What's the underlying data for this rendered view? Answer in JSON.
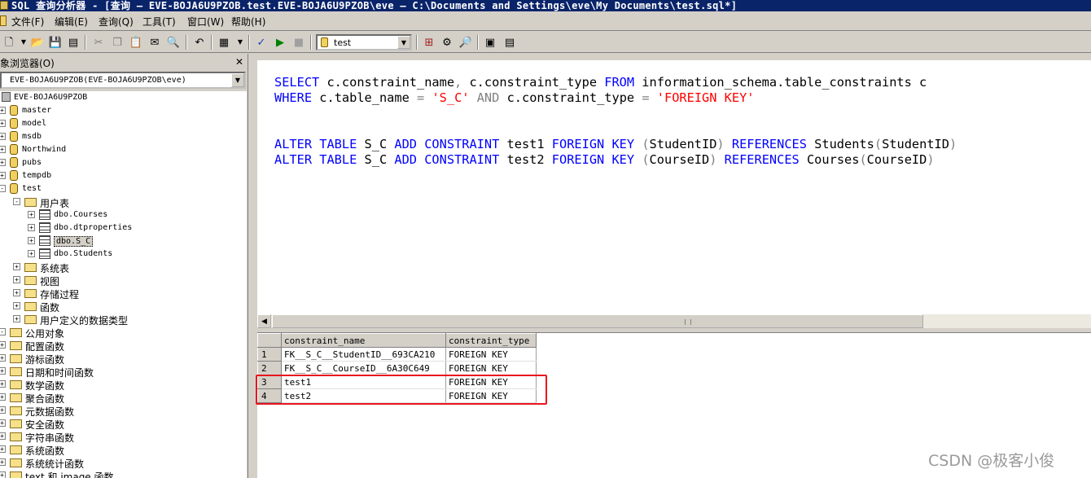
{
  "window": {
    "title": "SQL 查询分析器 - [查询 — EVE-BOJA6U9PZOB.test.EVE-BOJA6U9PZOB\\eve — C:\\Documents and Settings\\eve\\My Documents\\test.sql*]"
  },
  "menu": {
    "items": [
      "文件(F)",
      "编辑(E)",
      "查询(Q)",
      "工具(T)",
      "窗口(W)",
      "帮助(H)"
    ]
  },
  "toolbar": {
    "database": "test",
    "icons": [
      "new-query-icon",
      "open-icon",
      "save-icon",
      "load-script-icon",
      "cut-icon",
      "copy-icon",
      "paste-icon",
      "clear-icon",
      "find-icon",
      "undo-icon",
      "results-mode-icon",
      "parse-icon",
      "execute-icon",
      "stop-icon",
      "show-plan-icon",
      "object-browser-icon",
      "object-search-icon",
      "properties-icon",
      "show-results-icon"
    ]
  },
  "object_browser": {
    "title": "象浏览器(O)",
    "server_select": "EVE-BOJA6U9PZOB(EVE-BOJA6U9PZOB\\eve)",
    "tree": [
      {
        "label": "EVE-BOJA6U9PZOB",
        "type": "server",
        "level": 0
      },
      {
        "label": "master",
        "type": "db",
        "level": 1,
        "toggle": "+"
      },
      {
        "label": "model",
        "type": "db",
        "level": 1,
        "toggle": "+"
      },
      {
        "label": "msdb",
        "type": "db",
        "level": 1,
        "toggle": "+"
      },
      {
        "label": "Northwind",
        "type": "db",
        "level": 1,
        "toggle": "+"
      },
      {
        "label": "pubs",
        "type": "db",
        "level": 1,
        "toggle": "+"
      },
      {
        "label": "tempdb",
        "type": "db",
        "level": 1,
        "toggle": "+"
      },
      {
        "label": "test",
        "type": "db",
        "level": 1,
        "toggle": "-"
      },
      {
        "label": "用户表",
        "type": "folder",
        "level": 2,
        "toggle": "-"
      },
      {
        "label": "dbo.Courses",
        "type": "table",
        "level": 3,
        "toggle": "+"
      },
      {
        "label": "dbo.dtproperties",
        "type": "table",
        "level": 3,
        "toggle": "+"
      },
      {
        "label": "dbo.S_C",
        "type": "table",
        "level": 3,
        "toggle": "+",
        "selected": true
      },
      {
        "label": "dbo.Students",
        "type": "table",
        "level": 3,
        "toggle": "+"
      },
      {
        "label": "系统表",
        "type": "folder",
        "level": 2,
        "toggle": "+"
      },
      {
        "label": "视图",
        "type": "folder",
        "level": 2,
        "toggle": "+"
      },
      {
        "label": "存储过程",
        "type": "folder",
        "level": 2,
        "toggle": "+"
      },
      {
        "label": "函数",
        "type": "folder",
        "level": 2,
        "toggle": "+"
      },
      {
        "label": "用户定义的数据类型",
        "type": "folder",
        "level": 2,
        "toggle": "+"
      },
      {
        "label": "公用对象",
        "type": "folder",
        "level": 0,
        "toggle": "-"
      },
      {
        "label": "配置函数",
        "type": "folder",
        "level": 1,
        "toggle": "+"
      },
      {
        "label": "游标函数",
        "type": "folder",
        "level": 1,
        "toggle": "+"
      },
      {
        "label": "日期和时间函数",
        "type": "folder",
        "level": 1,
        "toggle": "+"
      },
      {
        "label": "数学函数",
        "type": "folder",
        "level": 1,
        "toggle": "+"
      },
      {
        "label": "聚合函数",
        "type": "folder",
        "level": 1,
        "toggle": "+"
      },
      {
        "label": "元数据函数",
        "type": "folder",
        "level": 1,
        "toggle": "+"
      },
      {
        "label": "安全函数",
        "type": "folder",
        "level": 1,
        "toggle": "+"
      },
      {
        "label": "字符串函数",
        "type": "folder",
        "level": 1,
        "toggle": "+"
      },
      {
        "label": "系统函数",
        "type": "folder",
        "level": 1,
        "toggle": "+"
      },
      {
        "label": "系统统计函数",
        "type": "folder",
        "level": 1,
        "toggle": "+"
      },
      {
        "label": "text 和 image 函数",
        "type": "folder",
        "level": 1,
        "toggle": "+"
      }
    ]
  },
  "editor": {
    "lines": [
      [
        [
          "kw",
          "SELECT"
        ],
        [
          "t",
          " c.constraint_name"
        ],
        [
          "op",
          ","
        ],
        [
          "t",
          " c.constraint_type "
        ],
        [
          "kw",
          "FROM"
        ],
        [
          "t",
          " information_schema.table_constraints c"
        ]
      ],
      [
        [
          "kw",
          "WHERE"
        ],
        [
          "t",
          " c.table_name "
        ],
        [
          "op",
          "="
        ],
        [
          "t",
          " "
        ],
        [
          "str",
          "'S_C'"
        ],
        [
          "t",
          " "
        ],
        [
          "op",
          "AND"
        ],
        [
          "t",
          " c.constraint_type "
        ],
        [
          "op",
          "="
        ],
        [
          "t",
          " "
        ],
        [
          "str",
          "'FOREIGN KEY'"
        ]
      ],
      [],
      [],
      [
        [
          "kw",
          "ALTER TABLE"
        ],
        [
          "t",
          " S_C "
        ],
        [
          "kw",
          "ADD CONSTRAINT"
        ],
        [
          "t",
          " test1 "
        ],
        [
          "kw",
          "FOREIGN KEY"
        ],
        [
          "t",
          " "
        ],
        [
          "op",
          "("
        ],
        [
          "t",
          "StudentID"
        ],
        [
          "op",
          ")"
        ],
        [
          "t",
          " "
        ],
        [
          "kw",
          "REFERENCES"
        ],
        [
          "t",
          " Students"
        ],
        [
          "op",
          "("
        ],
        [
          "t",
          "StudentID"
        ],
        [
          "op",
          ")"
        ]
      ],
      [
        [
          "kw",
          "ALTER TABLE"
        ],
        [
          "t",
          " S_C "
        ],
        [
          "kw",
          "ADD CONSTRAINT"
        ],
        [
          "t",
          " test2 "
        ],
        [
          "kw",
          "FOREIGN KEY"
        ],
        [
          "t",
          " "
        ],
        [
          "op",
          "("
        ],
        [
          "t",
          "CourseID"
        ],
        [
          "op",
          ")"
        ],
        [
          "t",
          " "
        ],
        [
          "kw",
          "REFERENCES"
        ],
        [
          "t",
          " Courses"
        ],
        [
          "op",
          "("
        ],
        [
          "t",
          "CourseID"
        ],
        [
          "op",
          ")"
        ]
      ]
    ]
  },
  "results": {
    "columns": [
      "constraint_name",
      "constraint_type"
    ],
    "rows": [
      [
        "1",
        "FK__S_C__StudentID__693CA210",
        "FOREIGN KEY"
      ],
      [
        "2",
        "FK__S_C__CourseID__6A30C649",
        "FOREIGN KEY"
      ],
      [
        "3",
        "test1",
        "FOREIGN KEY"
      ],
      [
        "4",
        "test2",
        "FOREIGN KEY"
      ]
    ],
    "highlight_color": "#e8161e"
  },
  "watermark": "CSDN @极客小俊"
}
